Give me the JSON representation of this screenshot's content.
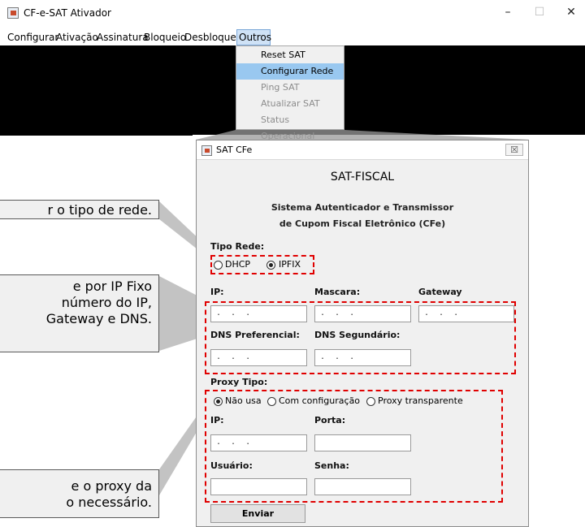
{
  "window": {
    "title": "CF-e-SAT Ativador",
    "controls": [
      "–",
      "☐",
      "✕"
    ]
  },
  "menubar": [
    "Configurar",
    "Ativação",
    "Assinatura",
    "Bloqueio",
    "Desbloqueio",
    "Outros"
  ],
  "dropdown": {
    "items": [
      {
        "label": "Reset SAT"
      },
      {
        "label": "Configurar Rede"
      },
      {
        "label": "Ping SAT"
      },
      {
        "label": "Atualizar SAT"
      },
      {
        "label": "Status Operacional"
      }
    ]
  },
  "dialog": {
    "title": "SAT CFe",
    "close": "☒",
    "heading": "SAT-FISCAL",
    "subtitle1": "Sistema Autenticador e Transmissor",
    "subtitle2": "de Cupom Fiscal Eletrônico (CFe)",
    "tipo_rede_label": "Tipo Rede:",
    "tipo_rede": {
      "dhcp": "DHCP",
      "ipfix": "IPFIX",
      "selected": "IPFIX"
    },
    "ip_label": "IP:",
    "mascara_label": "Mascara:",
    "gateway_label": "Gateway",
    "ip_value": " .  .  .",
    "mascara_value": " .  .  .",
    "gateway_value": " .  .  .",
    "dns_pref_label": "DNS Preferencial:",
    "dns_seg_label": "DNS Segundário:",
    "dns_pref_value": " .  .  .",
    "dns_seg_value": " .  .  .",
    "proxy_tipo_label": "Proxy Tipo:",
    "proxy": {
      "nao_usa": "Não usa",
      "com_config": "Com configuração",
      "transparente": "Proxy transparente",
      "selected": "Não usa"
    },
    "proxy_ip_label": "IP:",
    "porta_label": "Porta:",
    "proxy_ip_value": " .  .  .",
    "usuario_label": "Usuário:",
    "senha_label": "Senha:",
    "enviar": "Enviar"
  },
  "callouts": {
    "c1": "r o tipo de rede.",
    "c2": "e por IP Fixo\nnúmero do IP,\nGateway e DNS.",
    "c3": "e o proxy da\no necessário."
  },
  "colors": {
    "highlight": "#99c8f0",
    "annotation": "#e00000"
  }
}
